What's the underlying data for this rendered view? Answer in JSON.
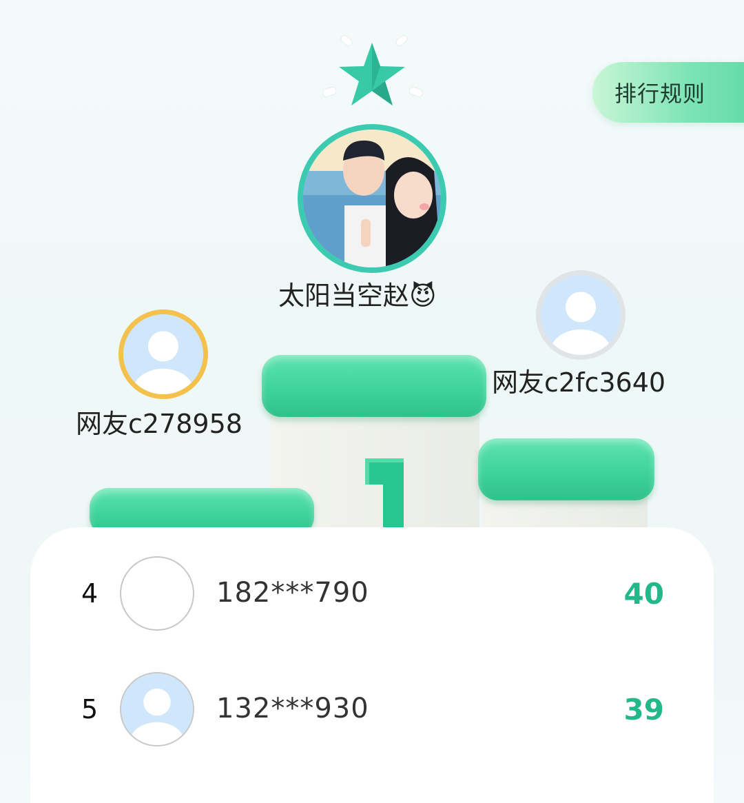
{
  "rules_button": {
    "label": "排行规则"
  },
  "podium": {
    "first": {
      "name": "太阳当空赵😈",
      "avatar": "couple-photo"
    },
    "second": {
      "name": "网友c278958",
      "avatar": "default-user"
    },
    "third": {
      "name": "网友c2fc3640",
      "avatar": "default-user"
    },
    "number_label": "1"
  },
  "list": [
    {
      "rank": "4",
      "name": "182***790",
      "score": "40",
      "avatar": "empty"
    },
    {
      "rank": "5",
      "name": "132***930",
      "score": "39",
      "avatar": "default-user"
    }
  ],
  "colors": {
    "accent": "#23b889",
    "podium_green": "#3fd39c",
    "second_ring": "#f3c14c",
    "third_ring": "#e1e4e6",
    "first_ring": "#3ccab1"
  }
}
